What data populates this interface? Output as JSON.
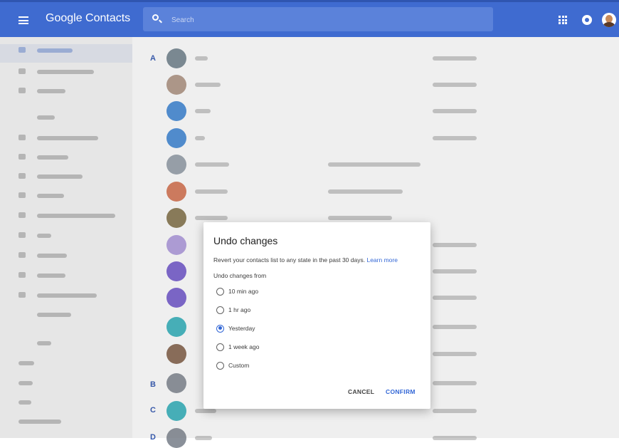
{
  "app": {
    "title": "Google Contacts"
  },
  "search": {
    "placeholder": "Search"
  },
  "colors": {
    "topbar": "#3f6bd0",
    "accent": "#3367d6"
  },
  "letters": [
    "A",
    "B",
    "C",
    "D"
  ],
  "dialog": {
    "title": "Undo changes",
    "description": "Revert your contacts list to any state in the past 30 days.",
    "learn_more": "Learn more",
    "subtitle": "Undo changes from",
    "options": [
      {
        "label": "10 min ago",
        "selected": false
      },
      {
        "label": "1 hr ago",
        "selected": false
      },
      {
        "label": "Yesterday",
        "selected": true
      },
      {
        "label": "1 week ago",
        "selected": false
      },
      {
        "label": "Custom",
        "selected": false
      }
    ],
    "cancel": "CANCEL",
    "confirm": "CONFIRM"
  }
}
